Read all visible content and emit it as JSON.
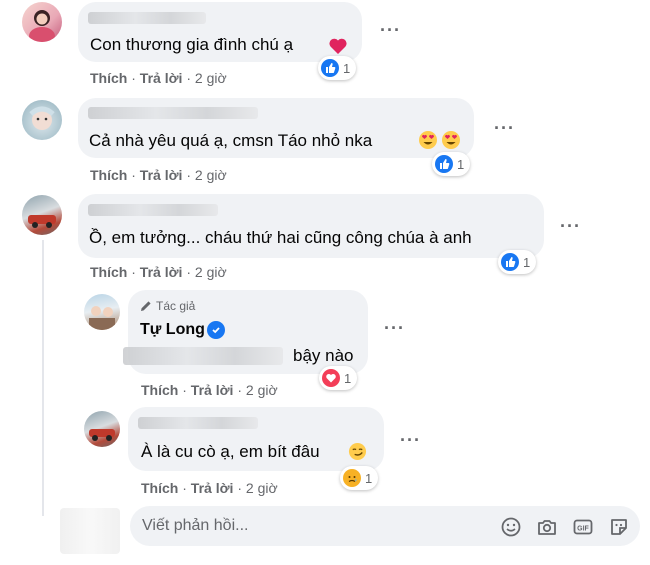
{
  "comments": [
    {
      "text": "Con thương gia đình chú ạ",
      "actions": {
        "like": "Thích",
        "reply": "Trả lời",
        "time": "2 giờ"
      },
      "reaction_count": "1",
      "reaction": "like-icon"
    },
    {
      "text": "Cả nhà yêu quá ạ, cmsn Táo nhỏ nka",
      "actions": {
        "like": "Thích",
        "reply": "Trả lời",
        "time": "2 giờ"
      },
      "reaction_count": "1",
      "reaction": "like-icon"
    },
    {
      "text": "Ồ, em tưởng... cháu thứ hai cũng công chúa à anh",
      "actions": {
        "like": "Thích",
        "reply": "Trả lời",
        "time": "2 giờ"
      },
      "reaction_count": "1",
      "reaction": "like-icon"
    }
  ],
  "replies": [
    {
      "author_badge": "Tác giả",
      "name": "Tự Long",
      "text": "bậy nào",
      "actions": {
        "like": "Thích",
        "reply": "Trả lời",
        "time": "2 giờ"
      },
      "reaction_count": "1",
      "reaction": "love-icon"
    },
    {
      "text": "À là cu cò ạ, em bít đâu",
      "actions": {
        "like": "Thích",
        "reply": "Trả lời",
        "time": "2 giờ"
      },
      "reaction_count": "1",
      "reaction": "sad-icon"
    }
  ],
  "reply_box": {
    "placeholder": "Viết phản hồi..."
  },
  "more_label": "···",
  "colors": {
    "like_blue": "#1877f2",
    "love_red": "#f33e58",
    "sad_yellow": "#f7b125",
    "bubble": "#f0f2f5",
    "meta": "#65676b"
  }
}
